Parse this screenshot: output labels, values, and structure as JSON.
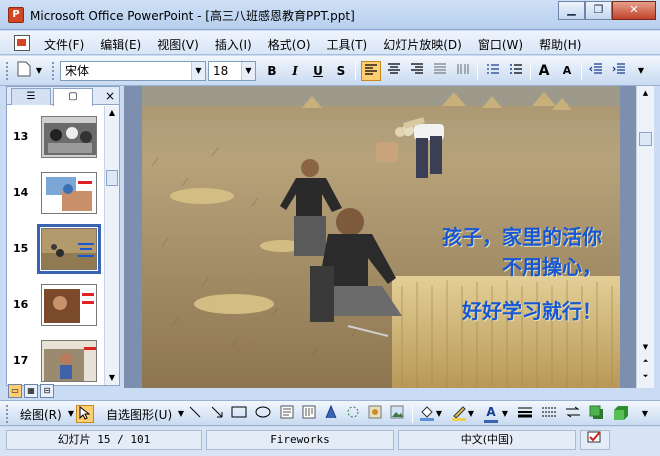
{
  "window": {
    "title": "Microsoft Office PowerPoint - [高三八班感恩教育PPT.ppt]",
    "minimize": "▁",
    "restore": "❐",
    "close": "✕"
  },
  "menu": [
    "文件(F)",
    "编辑(E)",
    "视图(V)",
    "插入(I)",
    "格式(O)",
    "工具(T)",
    "幻灯片放映(D)",
    "窗口(W)",
    "帮助(H)"
  ],
  "toolbar": {
    "font_name": "宋体",
    "font_size": "18",
    "bold": "B",
    "italic": "I",
    "underline": "U",
    "shadow": "S",
    "grow_font": "A",
    "shrink_font": "A"
  },
  "left_pane": {
    "close": "×",
    "slides": [
      {
        "number": "13"
      },
      {
        "number": "14"
      },
      {
        "number": "15",
        "selected": true
      },
      {
        "number": "16"
      },
      {
        "number": "17"
      }
    ]
  },
  "slide": {
    "caption_line1": "孩子，家里的活你",
    "caption_line2": "不用操心，",
    "caption_line3": "好好学习就行！",
    "caption_color": "#1757d6"
  },
  "drawing_toolbar": {
    "draw_label": "绘图(R)",
    "autoshapes_label": "自选图形(U)"
  },
  "status": {
    "slide_info": "幻灯片 15 / 101",
    "template": "Fireworks",
    "language": "中文(中国)"
  }
}
